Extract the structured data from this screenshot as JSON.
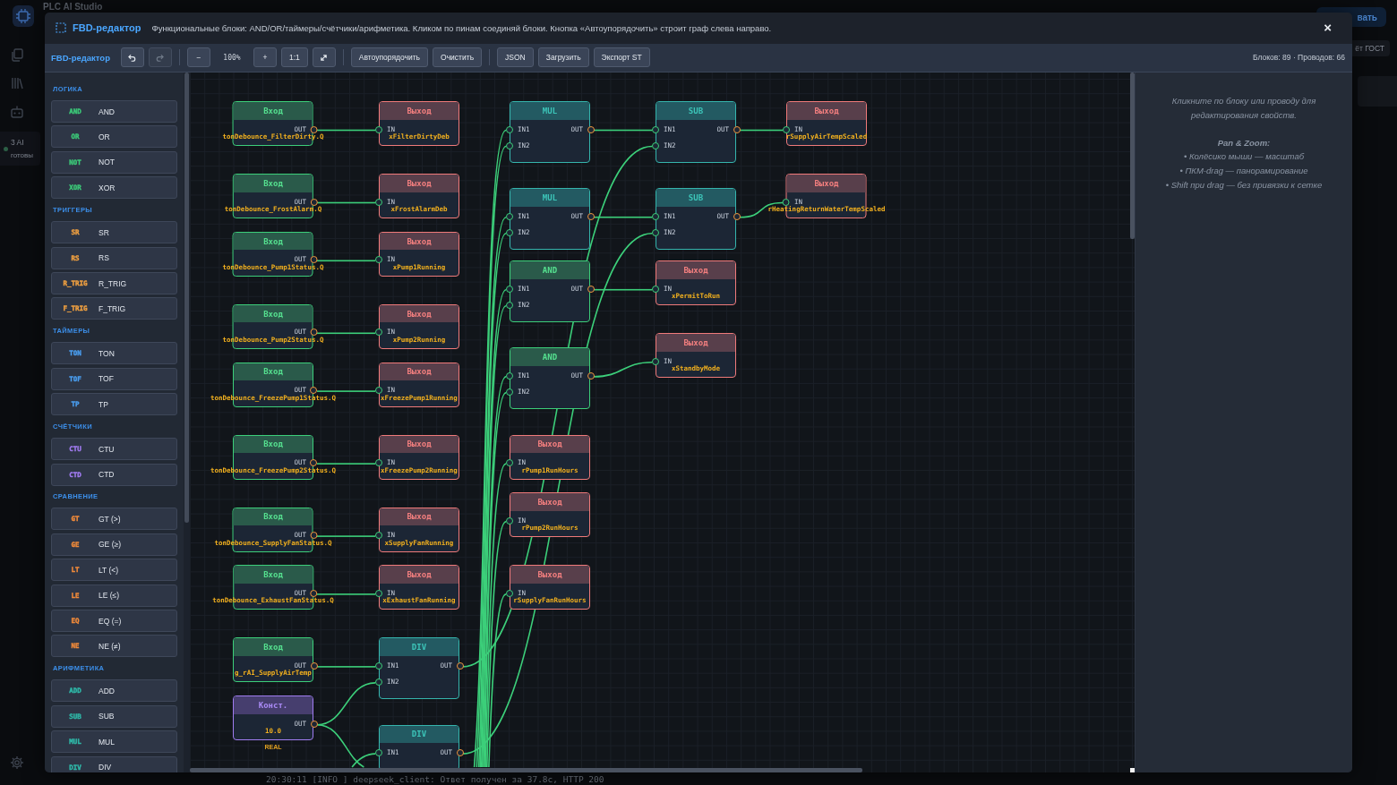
{
  "app": {
    "title": "PLC AI Studio",
    "ai_status": {
      "count": "3 AI",
      "state": "готовы"
    },
    "top_button": "вать",
    "side_button": "ёт ГОСТ",
    "log_line": "20:30:11 [INFO ] deepseek_client: Ответ получен за 37.8с, HTTP 200"
  },
  "dialog": {
    "title": "FBD-редактор",
    "description": "Функциональные блоки: AND/OR/таймеры/счётчики/арифметика. Кликом по пинам соединяй блоки. Кнопка «Автоупорядочить» строит граф слева направо.",
    "close": "×"
  },
  "toolbar": {
    "title": "FBD-редактор",
    "groups": [
      [
        {
          "kind": "icon",
          "disabled": false
        },
        {
          "kind": "icon",
          "disabled": true
        }
      ],
      [
        {
          "kind": "button",
          "text": "−",
          "disabled": false
        },
        {
          "kind": "readout",
          "text": "100%",
          "disabled": false
        },
        {
          "kind": "button",
          "text": "+",
          "disabled": false
        },
        {
          "kind": "button",
          "text": "1:1",
          "disabled": false
        },
        {
          "kind": "icon",
          "disabled": false
        }
      ],
      [
        {
          "kind": "button",
          "text": "Автоупорядочить",
          "disabled": false
        },
        {
          "kind": "button",
          "text": "Очистить",
          "disabled": false
        }
      ],
      [
        {
          "kind": "button",
          "text": "JSON",
          "disabled": false
        },
        {
          "kind": "button",
          "text": "Загрузить",
          "disabled": false
        },
        {
          "kind": "button",
          "text": "Экспорт ST",
          "disabled": false
        }
      ]
    ],
    "stats": "Блоков: 89 · Проводов: 66"
  },
  "palette": {
    "sections": [
      {
        "title": "ЛОГИКА",
        "color": "#3cc878",
        "items": [
          {
            "tag": "AND",
            "label": "AND"
          },
          {
            "tag": "OR",
            "label": "OR"
          },
          {
            "tag": "NOT",
            "label": "NOT"
          },
          {
            "tag": "XOR",
            "label": "XOR"
          }
        ]
      },
      {
        "title": "ТРИГГЕРЫ",
        "color": "#f0a040",
        "items": [
          {
            "tag": "SR",
            "label": "SR"
          },
          {
            "tag": "RS",
            "label": "RS"
          },
          {
            "tag": "R_TRIG",
            "label": "R_TRIG"
          },
          {
            "tag": "F_TRIG",
            "label": "F_TRIG"
          }
        ]
      },
      {
        "title": "ТАЙМЕРЫ",
        "color": "#4a9ef0",
        "items": [
          {
            "tag": "TON",
            "label": "TON"
          },
          {
            "tag": "TOF",
            "label": "TOF"
          },
          {
            "tag": "TP",
            "label": "TP"
          }
        ]
      },
      {
        "title": "СЧЁТЧИКИ",
        "color": "#a27cf2",
        "items": [
          {
            "tag": "CTU",
            "label": "CTU"
          },
          {
            "tag": "CTD",
            "label": "CTD"
          }
        ]
      },
      {
        "title": "СРАВНЕНИЕ",
        "color": "#f08a3a",
        "items": [
          {
            "tag": "GT",
            "label": "GT (>)"
          },
          {
            "tag": "GE",
            "label": "GE (≥)"
          },
          {
            "tag": "LT",
            "label": "LT (<)"
          },
          {
            "tag": "LE",
            "label": "LE (≤)"
          },
          {
            "tag": "EQ",
            "label": "EQ (=)"
          },
          {
            "tag": "NE",
            "label": "NE (≠)"
          }
        ]
      },
      {
        "title": "АРИФМЕТИКА",
        "color": "#2fb8a8",
        "items": [
          {
            "tag": "ADD",
            "label": "ADD"
          },
          {
            "tag": "SUB",
            "label": "SUB"
          },
          {
            "tag": "MUL",
            "label": "MUL"
          },
          {
            "tag": "DIV",
            "label": "DIV"
          }
        ]
      }
    ]
  },
  "canvas": {
    "blocks": [
      {
        "kind": "input",
        "title": "Вход",
        "outputs": [
          "OUT"
        ],
        "variable": "tonDebounce_FilterDirty.Q"
      },
      {
        "kind": "input",
        "title": "Вход",
        "outputs": [
          "OUT"
        ],
        "variable": "tonDebounce_FrostAlarm.Q"
      },
      {
        "kind": "input",
        "title": "Вход",
        "outputs": [
          "OUT"
        ],
        "variable": "tonDebounce_Pump1Status.Q"
      },
      {
        "kind": "input",
        "title": "Вход",
        "outputs": [
          "OUT"
        ],
        "variable": "tonDebounce_Pump2Status.Q"
      },
      {
        "kind": "input",
        "title": "Вход",
        "outputs": [
          "OUT"
        ],
        "variable": "tonDebounce_FreezePump1Status.Q"
      },
      {
        "kind": "input",
        "title": "Вход",
        "outputs": [
          "OUT"
        ],
        "variable": "tonDebounce_FreezePump2Status.Q"
      },
      {
        "kind": "input",
        "title": "Вход",
        "outputs": [
          "OUT"
        ],
        "variable": "tonDebounce_SupplyFanStatus.Q"
      },
      {
        "kind": "input",
        "title": "Вход",
        "outputs": [
          "OUT"
        ],
        "variable": "tonDebounce_ExhaustFanStatus.Q"
      },
      {
        "kind": "input",
        "title": "Вход",
        "outputs": [
          "OUT"
        ],
        "variable": "g_rAI_SupplyAirTemp"
      },
      {
        "kind": "const",
        "title": "Конст.",
        "outputs": [
          "OUT"
        ],
        "value": "10.0",
        "type": "REAL"
      },
      {
        "kind": "output",
        "title": "Выход",
        "inputs": [
          "IN"
        ],
        "variable": "xFilterDirtyDeb"
      },
      {
        "kind": "output",
        "title": "Выход",
        "inputs": [
          "IN"
        ],
        "variable": "xFrostAlarmDeb"
      },
      {
        "kind": "output",
        "title": "Выход",
        "inputs": [
          "IN"
        ],
        "variable": "xPump1Running"
      },
      {
        "kind": "output",
        "title": "Выход",
        "inputs": [
          "IN"
        ],
        "variable": "xPump2Running"
      },
      {
        "kind": "output",
        "title": "Выход",
        "inputs": [
          "IN"
        ],
        "variable": "xFreezePump1Running"
      },
      {
        "kind": "output",
        "title": "Выход",
        "inputs": [
          "IN"
        ],
        "variable": "xFreezePump2Running"
      },
      {
        "kind": "output",
        "title": "Выход",
        "inputs": [
          "IN"
        ],
        "variable": "xSupplyFanRunning"
      },
      {
        "kind": "output",
        "title": "Выход",
        "inputs": [
          "IN"
        ],
        "variable": "xExhaustFanRunning"
      },
      {
        "kind": "arith",
        "title": "DIV",
        "inputs": [
          "IN1",
          "IN2"
        ],
        "outputs": [
          "OUT"
        ]
      },
      {
        "kind": "arith",
        "title": "DIV",
        "inputs": [
          "IN1"
        ],
        "outputs": [
          "OUT"
        ]
      },
      {
        "kind": "arith",
        "title": "MUL",
        "inputs": [
          "IN1",
          "IN2"
        ],
        "outputs": [
          "OUT"
        ]
      },
      {
        "kind": "arith",
        "title": "MUL",
        "inputs": [
          "IN1",
          "IN2"
        ],
        "outputs": [
          "OUT"
        ]
      },
      {
        "kind": "logic",
        "title": "AND",
        "inputs": [
          "IN1",
          "IN2"
        ],
        "outputs": [
          "OUT"
        ]
      },
      {
        "kind": "logic",
        "title": "AND",
        "inputs": [
          "IN1",
          "IN2"
        ],
        "outputs": [
          "OUT"
        ]
      },
      {
        "kind": "output",
        "title": "Выход",
        "inputs": [
          "IN"
        ],
        "variable": "rPump1RunHours"
      },
      {
        "kind": "output",
        "title": "Выход",
        "inputs": [
          "IN"
        ],
        "variable": "rPump2RunHours"
      },
      {
        "kind": "output",
        "title": "Выход",
        "inputs": [
          "IN"
        ],
        "variable": "rSupplyFanRunHours"
      },
      {
        "kind": "arith",
        "title": "SUB",
        "inputs": [
          "IN1",
          "IN2"
        ],
        "outputs": [
          "OUT"
        ]
      },
      {
        "kind": "arith",
        "title": "SUB",
        "inputs": [
          "IN1",
          "IN2"
        ],
        "outputs": [
          "OUT"
        ]
      },
      {
        "kind": "output",
        "title": "Выход",
        "inputs": [
          "IN"
        ],
        "variable": "xPermitToRun"
      },
      {
        "kind": "output",
        "title": "Выход",
        "inputs": [
          "IN"
        ],
        "variable": "xStandbyMode"
      },
      {
        "kind": "output",
        "title": "Выход",
        "inputs": [
          "IN"
        ],
        "variable": "rSupplyAirTempScaled"
      },
      {
        "kind": "output",
        "title": "Выход",
        "inputs": [
          "IN"
        ],
        "variable": "rHeatingReturnWaterTempScaled"
      }
    ]
  },
  "properties": {
    "hint": "Кликните по блоку или проводу для редактирования свойств.",
    "help_title": "Pan & Zoom:",
    "help_items": [
      "• Колёсико мыши — масштаб",
      "• ПКМ-drag — панорамирование",
      "• Shift при drag — без привязки к сетке"
    ]
  }
}
